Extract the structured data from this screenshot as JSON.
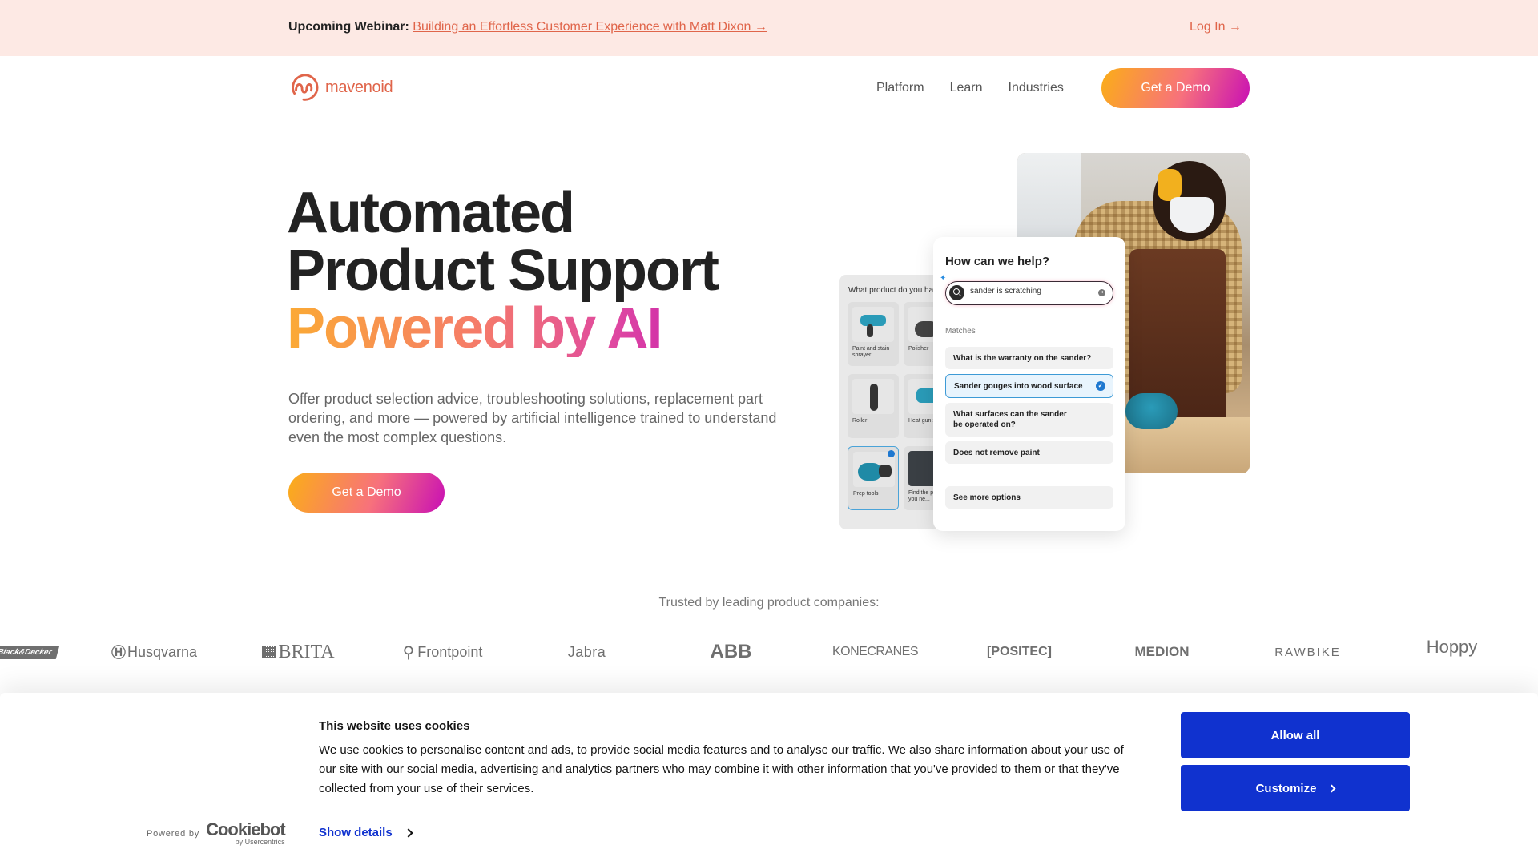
{
  "announcement": {
    "label": "Upcoming Webinar:",
    "link_text": "Building an Effortless Customer Experience with Matt Dixon →",
    "login": "Log In →"
  },
  "nav": {
    "logo_text": "mavenoid",
    "links": [
      "Platform",
      "Learn",
      "Industries"
    ],
    "cta": "Get a Demo"
  },
  "hero": {
    "title_line1": "Automated",
    "title_line2": "Product Support",
    "title_line3": "Powered by AI",
    "subtitle": "Offer product selection advice, troubleshooting solutions, replacement part ordering, and more — powered by artificial intelligence trained to understand even the most complex questions.",
    "cta": "Get a Demo"
  },
  "mockup": {
    "product_panel_title": "What product do you have?",
    "products": [
      {
        "label": "Paint and stain sprayer",
        "selected": false
      },
      {
        "label": "Polisher",
        "selected": false
      },
      {
        "label": "Roller",
        "selected": false
      },
      {
        "label": "Heat gun s...",
        "selected": false
      },
      {
        "label": "Prep tools",
        "selected": true
      },
      {
        "label": "Find the pr... tool you ne...",
        "selected": false
      }
    ],
    "help_title": "How can we help?",
    "search_value": "sander is scratching",
    "matches_label": "Matches",
    "matches": [
      {
        "text": "What is the warranty on the sander?",
        "selected": false
      },
      {
        "text": "Sander gouges into wood surface",
        "selected": true
      },
      {
        "text": "What surfaces can the sander be operated on?",
        "selected": false
      },
      {
        "text": "Does not remove paint",
        "selected": false
      }
    ],
    "see_more": "See more options"
  },
  "trusted": {
    "label": "Trusted by leading product companies:",
    "brands": [
      "Black&Decker",
      "Husqvarna",
      "BRITA",
      "Frontpoint",
      "Jabra",
      "ABB",
      "KONECRANES",
      "POSITEC",
      "MEDION",
      "RAWBIKE",
      "Hoppy"
    ]
  },
  "cookie": {
    "title": "This website uses cookies",
    "body": "We use cookies to personalise content and ads, to provide social media features and to analyse our traffic. We also share information about your use of our site with our social media, advertising and analytics partners who may combine it with other information that you've provided to them or that they've collected from your use of their services.",
    "powered_by": "Powered by",
    "cookiebot": "Cookiebot",
    "cookiebot_sub": "by Usercentrics",
    "show_details": "Show details",
    "allow_all": "Allow all",
    "customize": "Customize"
  },
  "colors": {
    "brand_orange": "#e0654a",
    "announce_bg": "#fde9e4",
    "cookie_blue": "#1032cf",
    "gradient_start": "#fbae17",
    "gradient_end": "#c80fb5"
  }
}
